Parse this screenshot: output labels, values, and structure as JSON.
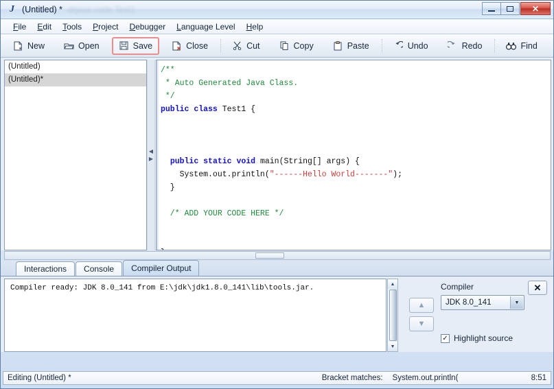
{
  "window": {
    "title": "(Untitled) *",
    "ghost_title": "drjava  code  Test1",
    "app_icon": "java-cup-icon",
    "minimize_label": "Minimize",
    "maximize_label": "Maximize",
    "close_label": "✕"
  },
  "menubar": {
    "items": [
      {
        "label": "File",
        "mnemonic": "F"
      },
      {
        "label": "Edit",
        "mnemonic": "E"
      },
      {
        "label": "Tools",
        "mnemonic": "T"
      },
      {
        "label": "Project",
        "mnemonic": "P"
      },
      {
        "label": "Debugger",
        "mnemonic": "D"
      },
      {
        "label": "Language Level",
        "mnemonic": "L"
      },
      {
        "label": "Help",
        "mnemonic": "H"
      }
    ]
  },
  "toolbar": {
    "buttons": [
      {
        "label": "New",
        "icon": "new-file-icon",
        "highlighted": false
      },
      {
        "label": "Open",
        "icon": "open-folder-icon",
        "highlighted": false
      },
      {
        "label": "Save",
        "icon": "floppy-disk-icon",
        "highlighted": true
      },
      {
        "label": "Close",
        "icon": "close-file-icon",
        "highlighted": false
      },
      {
        "label": "Cut",
        "icon": "scissors-icon",
        "highlighted": false
      },
      {
        "label": "Copy",
        "icon": "copy-pages-icon",
        "highlighted": false
      },
      {
        "label": "Paste",
        "icon": "clipboard-icon",
        "highlighted": false
      },
      {
        "label": "Undo",
        "icon": "undo-arrow-icon",
        "highlighted": false
      },
      {
        "label": "Redo",
        "icon": "redo-arrow-icon",
        "highlighted": false
      },
      {
        "label": "Find",
        "icon": "binoculars-icon",
        "highlighted": false
      }
    ]
  },
  "filelist": {
    "items": [
      {
        "label": "(Untitled)",
        "selected": false
      },
      {
        "label": "(Untitled)*",
        "selected": true
      }
    ]
  },
  "editor": {
    "lines": [
      {
        "segments": [
          {
            "t": "/**",
            "c": "cmt"
          }
        ]
      },
      {
        "segments": [
          {
            "t": " * Auto Generated Java Class.",
            "c": "cmt"
          }
        ]
      },
      {
        "segments": [
          {
            "t": " */",
            "c": "cmt"
          }
        ]
      },
      {
        "segments": [
          {
            "t": "public",
            "c": "kw"
          },
          {
            "t": " ",
            "c": "plain"
          },
          {
            "t": "class",
            "c": "kw"
          },
          {
            "t": " Test1 {",
            "c": "plain"
          }
        ]
      },
      {
        "segments": [
          {
            "t": "",
            "c": "plain"
          }
        ]
      },
      {
        "segments": [
          {
            "t": "",
            "c": "plain"
          }
        ]
      },
      {
        "segments": [
          {
            "t": "",
            "c": "plain"
          }
        ]
      },
      {
        "segments": [
          {
            "t": "  ",
            "c": "plain"
          },
          {
            "t": "public",
            "c": "kw"
          },
          {
            "t": " ",
            "c": "plain"
          },
          {
            "t": "static",
            "c": "kw"
          },
          {
            "t": " ",
            "c": "plain"
          },
          {
            "t": "void",
            "c": "kw"
          },
          {
            "t": " main(String[] args) {",
            "c": "plain"
          }
        ]
      },
      {
        "segments": [
          {
            "t": "    System.out.println(",
            "c": "plain"
          },
          {
            "t": "\"------Hello World-------\"",
            "c": "str"
          },
          {
            "t": ");",
            "c": "plain"
          }
        ]
      },
      {
        "segments": [
          {
            "t": "  }",
            "c": "plain"
          }
        ]
      },
      {
        "segments": [
          {
            "t": "",
            "c": "plain"
          }
        ]
      },
      {
        "segments": [
          {
            "t": "  /* ADD YOUR CODE HERE */",
            "c": "cmt"
          }
        ]
      },
      {
        "segments": [
          {
            "t": "",
            "c": "plain"
          }
        ]
      },
      {
        "segments": [
          {
            "t": "",
            "c": "plain"
          }
        ]
      },
      {
        "segments": [
          {
            "t": "}",
            "c": "plain"
          }
        ]
      }
    ]
  },
  "tabs": [
    {
      "label": "Interactions",
      "active": false
    },
    {
      "label": "Console",
      "active": false
    },
    {
      "label": "Compiler Output",
      "active": true
    }
  ],
  "console": {
    "text": "Compiler ready: JDK 8.0_141 from E:\\jdk\\jdk1.8.0_141\\lib\\tools.jar."
  },
  "compiler_panel": {
    "label": "Compiler",
    "selected_compiler": "JDK 8.0_141",
    "dropdown_arrow": "▼",
    "close_label": "✕",
    "prev_label": "▲",
    "next_label": "▼",
    "highlight_source_label": "Highlight source",
    "highlight_source_checked": true,
    "checkmark": "✓"
  },
  "statusbar": {
    "editing": "Editing (Untitled) *",
    "bracket_label": "Bracket matches:",
    "bracket_value": "System.out.println(",
    "position": "8:51"
  },
  "colors": {
    "keyword": "#1212c8",
    "comment": "#1f8a3c",
    "string": "#d23a3a",
    "highlight_border": "#f08b8b",
    "close_button": "#b92e23"
  }
}
